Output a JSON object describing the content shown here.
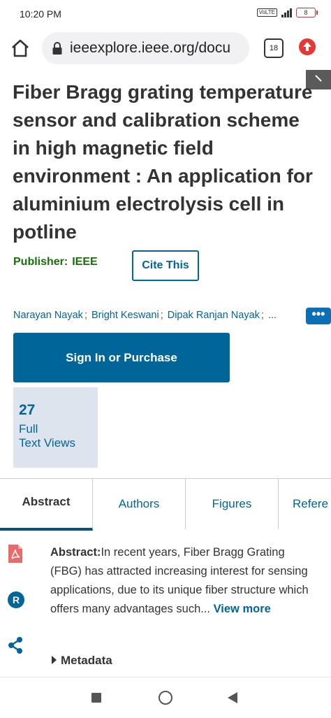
{
  "status_bar": {
    "time": "10:20 PM",
    "network": "VoLTE",
    "battery": "8"
  },
  "browser": {
    "url": "ieeexplore.ieee.org/docu",
    "tab_count": "18",
    "icons": [
      "home-icon",
      "lock-icon",
      "tab-switcher-icon",
      "update-icon"
    ]
  },
  "article": {
    "title": "Fiber Bragg grating temperature sensor and calibration scheme in high magnetic field environment : An application for aluminium electrolysis cell in potline",
    "publisher_label": "Publisher:",
    "publisher_name": "IEEE",
    "cite_label": "Cite This",
    "authors": [
      "Narayan Nayak",
      "Bright Keswani",
      "Dipak Ranjan Nayak"
    ],
    "authors_more": "...",
    "more_button": "•••",
    "signin_label": "Sign In or Purchase",
    "metric": {
      "value": "27",
      "label_line1": "Full",
      "label_line2": "Text Views"
    }
  },
  "tabs": [
    {
      "label": "Abstract",
      "active": true
    },
    {
      "label": "Authors",
      "active": false
    },
    {
      "label": "Figures",
      "active": false
    },
    {
      "label": "Refere",
      "active": false
    }
  ],
  "side_icons": [
    "pdf-icon",
    "rights-icon",
    "share-icon"
  ],
  "abstract": {
    "heading": "Abstract:",
    "text": "In recent years, Fiber Bragg Grating (FBG) has attracted increasing interest for sensing applications, due to its unique fiber structure which offers many advantages such... ",
    "view_more": "View more"
  },
  "metadata_label": "Metadata",
  "colors": {
    "link_blue": "#006699",
    "publisher_green": "#19700a",
    "metric_bg": "#dde4ee",
    "pdf_red": "#e96a6a"
  }
}
